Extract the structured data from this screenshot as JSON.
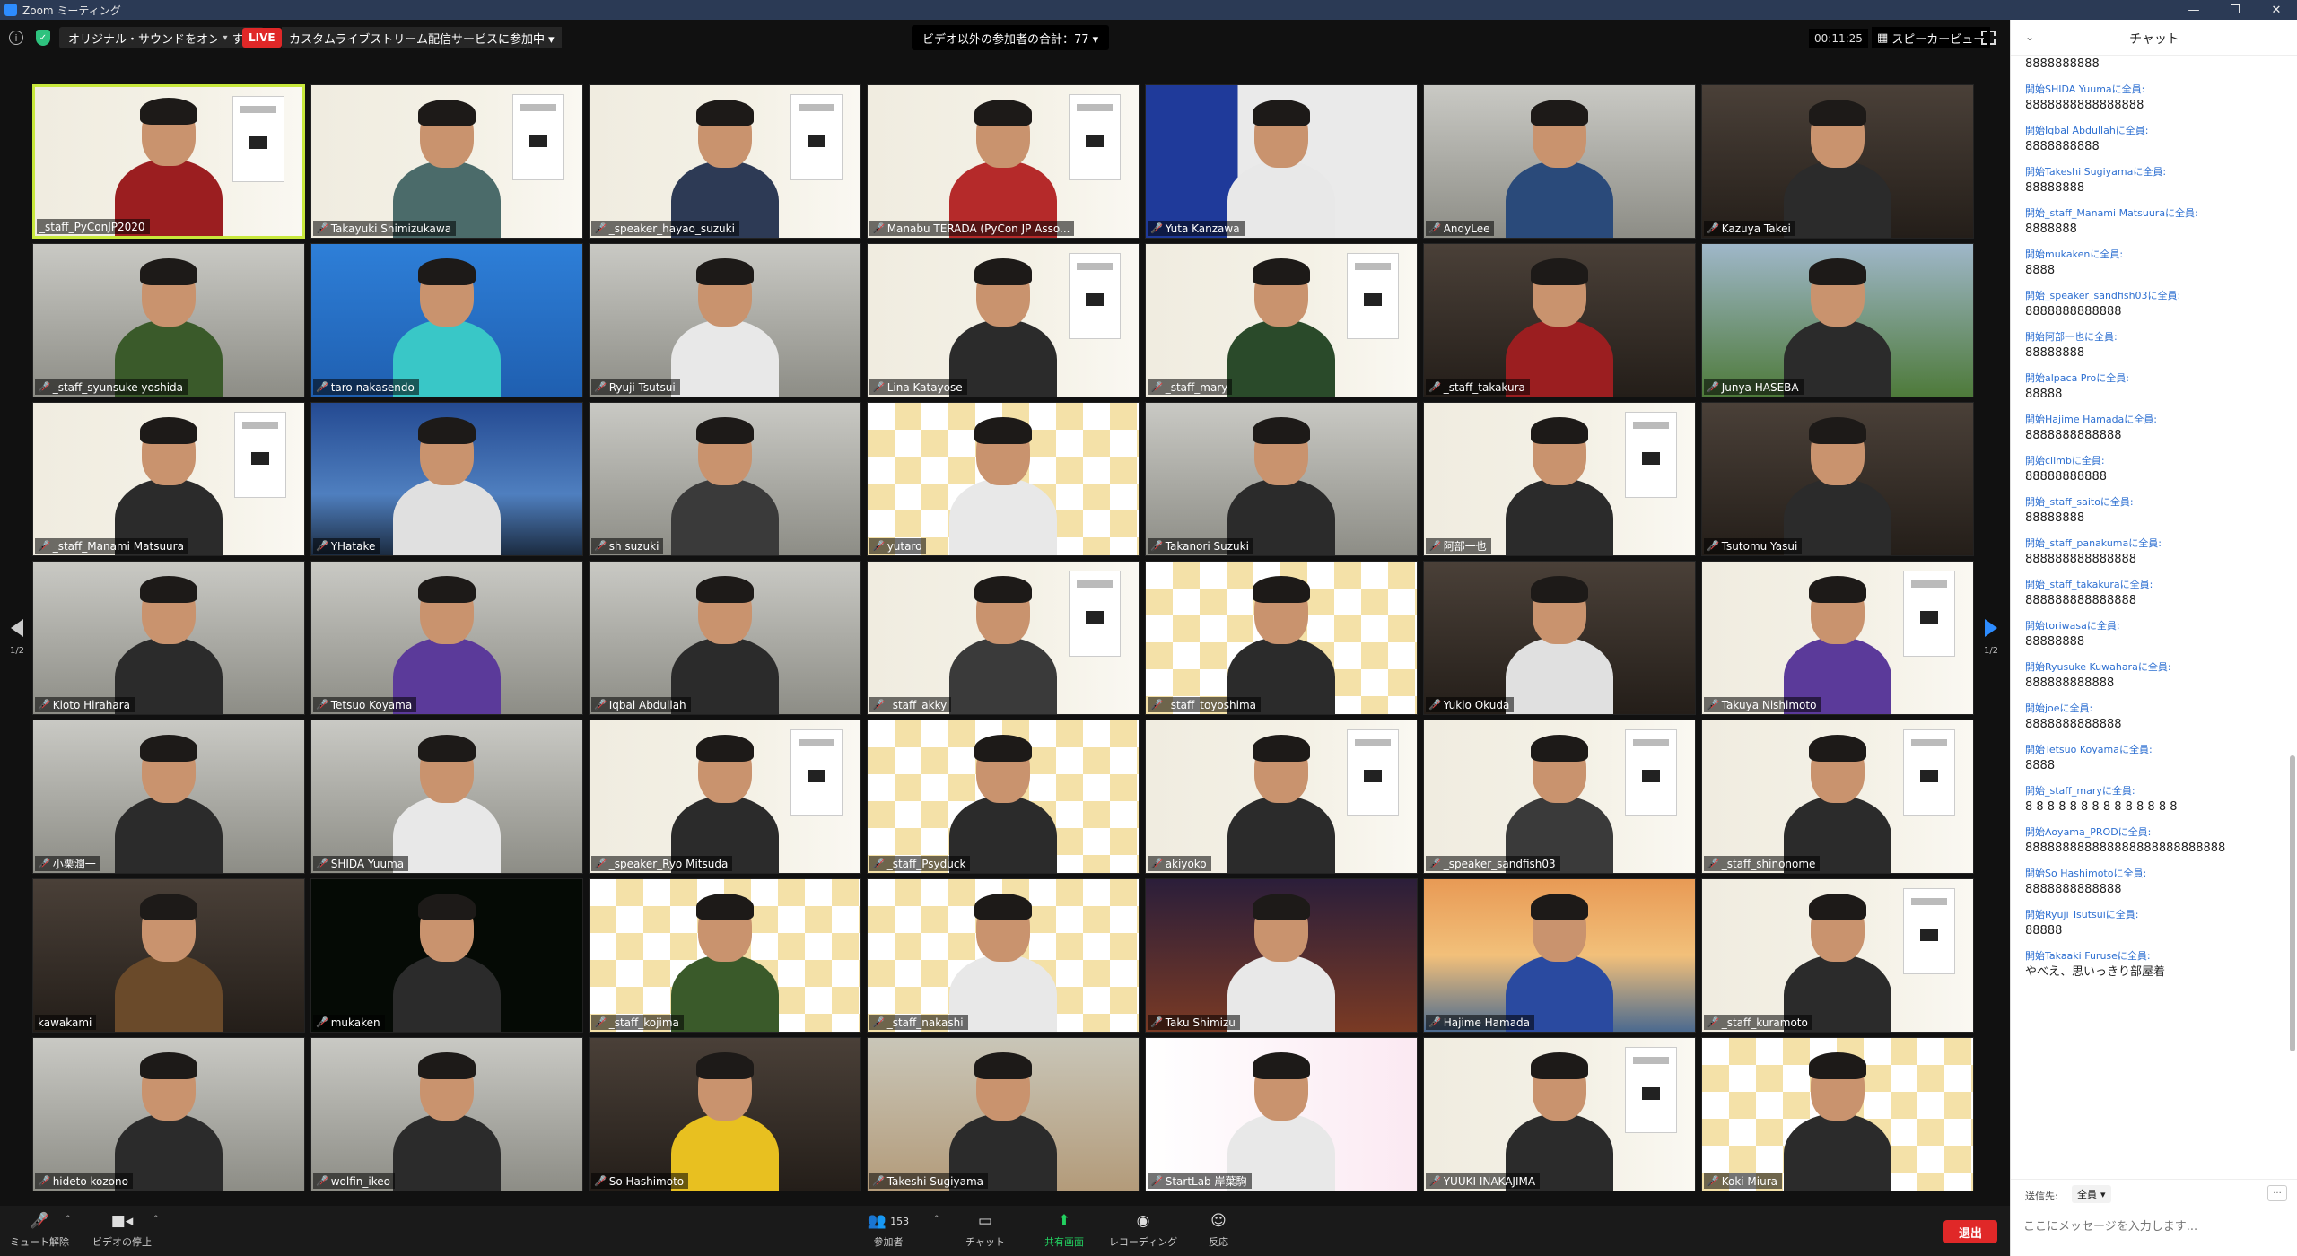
{
  "window": {
    "title": "Zoom ミーティング",
    "controls": [
      "—",
      "❐",
      "✕"
    ]
  },
  "topbar": {
    "original_sound": "オリジナル・サウンドをオンにする",
    "live_badge": "LIVE",
    "live_text": "カスタムライブストリーム配信サービスに参加中 ▾",
    "non_video_count": "ビデオ以外の参加者の合計：77 ▾",
    "timer": "00:11:25",
    "speaker_view": "スピーカービュー"
  },
  "gallery": {
    "page": "1/2",
    "tiles": [
      {
        "name": "_staff_PyConJP2020",
        "muted": false,
        "bg": "bg-board",
        "shirt": "#9b1e20",
        "active": true
      },
      {
        "name": "Takayuki Shimizukawa",
        "muted": true,
        "bg": "bg-board",
        "shirt": "#4b6b6a"
      },
      {
        "name": "_speaker_hayao_suzuki",
        "muted": true,
        "bg": "bg-board",
        "shirt": "#2d3a55"
      },
      {
        "name": "Manabu TERADA (PyCon JP Asso...",
        "muted": true,
        "bg": "bg-board",
        "shirt": "#b52a2a"
      },
      {
        "name": "Yuta Kanzawa",
        "muted": true,
        "bg": "bg-jnj",
        "shirt": "#e8e8e8"
      },
      {
        "name": "AndyLee",
        "muted": true,
        "bg": "bg-room",
        "shirt": "#2a4a7a"
      },
      {
        "name": "Kazuya Takei",
        "muted": true,
        "bg": "bg-dark",
        "shirt": "#2b2b2b"
      },
      {
        "name": "_staff_syunsuke yoshida",
        "muted": true,
        "bg": "bg-room",
        "shirt": "#3a5a2a"
      },
      {
        "name": "taro nakasendo",
        "muted": true,
        "bg": "bg-blue",
        "shirt": "#39c7c7"
      },
      {
        "name": "Ryuji Tsutsui",
        "muted": true,
        "bg": "bg-room",
        "shirt": "#e8e8e8"
      },
      {
        "name": "Lina Katayose",
        "muted": true,
        "bg": "bg-board",
        "shirt": "#2b2b2b"
      },
      {
        "name": "_staff_mary",
        "muted": true,
        "bg": "bg-board",
        "shirt": "#2a4a2a"
      },
      {
        "name": "_staff_takakura",
        "muted": true,
        "bg": "bg-dark",
        "shirt": "#9b1e20"
      },
      {
        "name": "Junya HASEBA",
        "muted": true,
        "bg": "bg-stadium",
        "shirt": "#2b2b2b"
      },
      {
        "name": "_staff_Manami Matsuura",
        "muted": true,
        "bg": "bg-board",
        "shirt": "#2b2b2b"
      },
      {
        "name": "YHatake",
        "muted": true,
        "bg": "bg-sky",
        "shirt": "#e0e0e0"
      },
      {
        "name": "sh suzuki",
        "muted": true,
        "bg": "bg-room",
        "shirt": "#3a3a3a"
      },
      {
        "name": "yutaro",
        "muted": true,
        "bg": "bg-check",
        "shirt": "#e8e8e8"
      },
      {
        "name": "Takanori Suzuki",
        "muted": true,
        "bg": "bg-room",
        "shirt": "#2b2b2b"
      },
      {
        "name": "阿部一也",
        "muted": true,
        "bg": "bg-board",
        "shirt": "#2b2b2b"
      },
      {
        "name": "Tsutomu Yasui",
        "muted": true,
        "bg": "bg-dark",
        "shirt": "#2b2b2b"
      },
      {
        "name": "Kioto Hirahara",
        "muted": true,
        "bg": "bg-room",
        "shirt": "#2b2b2b"
      },
      {
        "name": "Tetsuo Koyama",
        "muted": true,
        "bg": "bg-room",
        "shirt": "#5b3a9a"
      },
      {
        "name": "Iqbal Abdullah",
        "muted": true,
        "bg": "bg-room",
        "shirt": "#2b2b2b"
      },
      {
        "name": "_staff_akky",
        "muted": true,
        "bg": "bg-board",
        "shirt": "#3a3a3a"
      },
      {
        "name": "_staff_toyoshima",
        "muted": true,
        "bg": "bg-check",
        "shirt": "#2b2b2b"
      },
      {
        "name": "Yukio Okuda",
        "muted": true,
        "bg": "bg-dark",
        "shirt": "#e0e0e0"
      },
      {
        "name": "Takuya Nishimoto",
        "muted": true,
        "bg": "bg-board",
        "shirt": "#5b3a9a"
      },
      {
        "name": "小栗潤一",
        "muted": true,
        "bg": "bg-room",
        "shirt": "#2b2b2b"
      },
      {
        "name": "SHIDA Yuuma",
        "muted": true,
        "bg": "bg-room",
        "shirt": "#e8e8e8"
      },
      {
        "name": "_speaker_Ryo Mitsuda",
        "muted": true,
        "bg": "bg-board",
        "shirt": "#2b2b2b"
      },
      {
        "name": "_staff_Psyduck",
        "muted": true,
        "bg": "bg-check",
        "shirt": "#2b2b2b"
      },
      {
        "name": "akiyoko",
        "muted": true,
        "bg": "bg-board",
        "shirt": "#2b2b2b"
      },
      {
        "name": "_speaker_sandfish03",
        "muted": true,
        "bg": "bg-board",
        "shirt": "#3a3a3a"
      },
      {
        "name": "_staff_shinonome",
        "muted": true,
        "bg": "bg-board",
        "shirt": "#2b2b2b"
      },
      {
        "name": "kawakami",
        "muted": false,
        "bg": "bg-dark",
        "shirt": "#6a4a2a"
      },
      {
        "name": "mukaken",
        "muted": true,
        "bg": "bg-terminal",
        "shirt": "#2b2b2b"
      },
      {
        "name": "_staff_kojima",
        "muted": true,
        "bg": "bg-check",
        "shirt": "#3a5a2a"
      },
      {
        "name": "_staff_nakashi",
        "muted": true,
        "bg": "bg-check",
        "shirt": "#e8e8e8"
      },
      {
        "name": "Taku Shimizu",
        "muted": true,
        "bg": "bg-church",
        "shirt": "#e8e8e8"
      },
      {
        "name": "Hajime Hamada",
        "muted": true,
        "bg": "bg-sunset",
        "shirt": "#2a4aa0"
      },
      {
        "name": "_staff_kuramoto",
        "muted": true,
        "bg": "bg-board",
        "shirt": "#2b2b2b"
      },
      {
        "name": "hideto kozono",
        "muted": true,
        "bg": "bg-room",
        "shirt": "#2b2b2b"
      },
      {
        "name": "wolfin_ikeo",
        "muted": true,
        "bg": "bg-room",
        "shirt": "#2b2b2b"
      },
      {
        "name": "So Hashimoto",
        "muted": true,
        "bg": "bg-dark",
        "shirt": "#e8c020"
      },
      {
        "name": "Takeshi Sugiyama",
        "muted": true,
        "bg": "bg-beach",
        "shirt": "#2b2b2b"
      },
      {
        "name": "StartLab 岸葉駒",
        "muted": true,
        "bg": "bg-startlab",
        "shirt": "#e8e8e8"
      },
      {
        "name": "YUUKI INAKAJIMA",
        "muted": true,
        "bg": "bg-board",
        "shirt": "#2b2b2b"
      },
      {
        "name": "Koki Miura",
        "muted": true,
        "bg": "bg-check",
        "shirt": "#2b2b2b"
      }
    ]
  },
  "toolbar": {
    "mute": "ミュート解除",
    "video": "ビデオの停止",
    "participants": "参加者",
    "participants_count": "153",
    "chat": "チャット",
    "share": "共有画面",
    "record": "レコーディング",
    "reactions": "反応",
    "leave": "退出"
  },
  "chat": {
    "title": "チャット",
    "messages": [
      {
        "meta": "",
        "text": "8888888888"
      },
      {
        "meta": "開始SHIDA Yuumaに全員:",
        "text": "8888888888888888"
      },
      {
        "meta": "開始Iqbal Abdullahに全員:",
        "text": "8888888888"
      },
      {
        "meta": "開始Takeshi Sugiyamaに全員:",
        "text": "88888888"
      },
      {
        "meta": "開始_staff_Manami Matsuuraに全員:",
        "text": "8888888"
      },
      {
        "meta": "開始mukakenに全員:",
        "text": "8888"
      },
      {
        "meta": "開始_speaker_sandfish03に全員:",
        "text": "8888888888888"
      },
      {
        "meta": "開始阿部一也に全員:",
        "text": "88888888"
      },
      {
        "meta": "開始alpaca Proに全員:",
        "text": "88888"
      },
      {
        "meta": "開始Hajime Hamadaに全員:",
        "text": "8888888888888"
      },
      {
        "meta": "開始climbに全員:",
        "text": "88888888888"
      },
      {
        "meta": "開始_staff_saitoに全員:",
        "text": "88888888"
      },
      {
        "meta": "開始_staff_panakumaに全員:",
        "text": "888888888888888"
      },
      {
        "meta": "開始_staff_takakuraに全員:",
        "text": "888888888888888"
      },
      {
        "meta": "開始toriwasaに全員:",
        "text": "88888888"
      },
      {
        "meta": "開始Ryusuke Kuwaharaに全員:",
        "text": "888888888888"
      },
      {
        "meta": "開始joeに全員:",
        "text": "8888888888888"
      },
      {
        "meta": "開始Tetsuo Koyamaに全員:",
        "text": "8888"
      },
      {
        "meta": "開始_staff_maryに全員:",
        "text": "8 8 8 8 8 8 8 8 8 8 8 8 8 8"
      },
      {
        "meta": "開始Aoyama_PRODに全員:",
        "text": "888888888888888888888888888"
      },
      {
        "meta": "開始So Hashimotoに全員:",
        "text": "8888888888888"
      },
      {
        "meta": "開始Ryuji Tsutsuiに全員:",
        "text": "88888"
      },
      {
        "meta": "開始Takaaki Furuseに全員:",
        "text": "やべえ、思いっきり部屋着"
      }
    ],
    "to_label": "送信先:",
    "to_value": "全員",
    "input_placeholder": "ここにメッセージを入力します..."
  }
}
